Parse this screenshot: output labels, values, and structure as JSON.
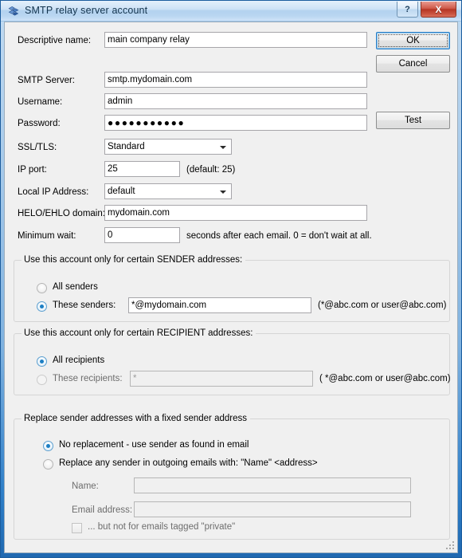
{
  "window": {
    "title": "SMTP relay server account",
    "icon": "smtp-relay-icon",
    "help_button": "?",
    "close_button": "X"
  },
  "buttons": {
    "ok": "OK",
    "cancel": "Cancel",
    "test": "Test"
  },
  "fields": {
    "descriptive_name": {
      "label": "Descriptive name:",
      "value": "main company relay"
    },
    "smtp_server": {
      "label": "SMTP Server:",
      "value": "smtp.mydomain.com"
    },
    "username": {
      "label": "Username:",
      "value": "admin"
    },
    "password": {
      "label": "Password:",
      "value": "●●●●●●●●●●●"
    },
    "ssl_tls": {
      "label": "SSL/TLS:",
      "value": "Standard"
    },
    "ip_port": {
      "label": "IP port:",
      "value": "25",
      "hint": "(default: 25)"
    },
    "local_ip_address": {
      "label": "Local IP Address:",
      "value": "default"
    },
    "helo_ehlo_domain": {
      "label": "HELO/EHLO domain:",
      "value": "mydomain.com"
    },
    "minimum_wait": {
      "label": "Minimum wait:",
      "value": "0",
      "hint": "seconds after each email. 0 = don't wait at all."
    }
  },
  "sender_group": {
    "title": "Use this account only for certain SENDER addresses:",
    "all_senders_label": "All senders",
    "these_senders_label": "These senders:",
    "these_senders_value": "*@mydomain.com",
    "hint": "(*@abc.com or user@abc.com)",
    "selected": "these_senders"
  },
  "recipient_group": {
    "title": "Use this account only for certain RECIPIENT addresses:",
    "all_recipients_label": "All recipients",
    "these_recipients_label": "These recipients:",
    "these_recipients_value": "*",
    "hint": "( *@abc.com or user@abc.com)",
    "selected": "all_recipients"
  },
  "replace_group": {
    "title": "Replace sender addresses with a fixed sender address",
    "no_replacement_label": "No replacement - use sender as found in email",
    "replace_label": "Replace any sender in outgoing emails with:    \"Name\" <address>",
    "name_label": "Name:",
    "name_value": "",
    "email_label": "Email address:",
    "email_value": "",
    "private_checkbox_label": "... but not for emails tagged \"private\"",
    "selected": "no_replacement",
    "private_checked": false
  }
}
